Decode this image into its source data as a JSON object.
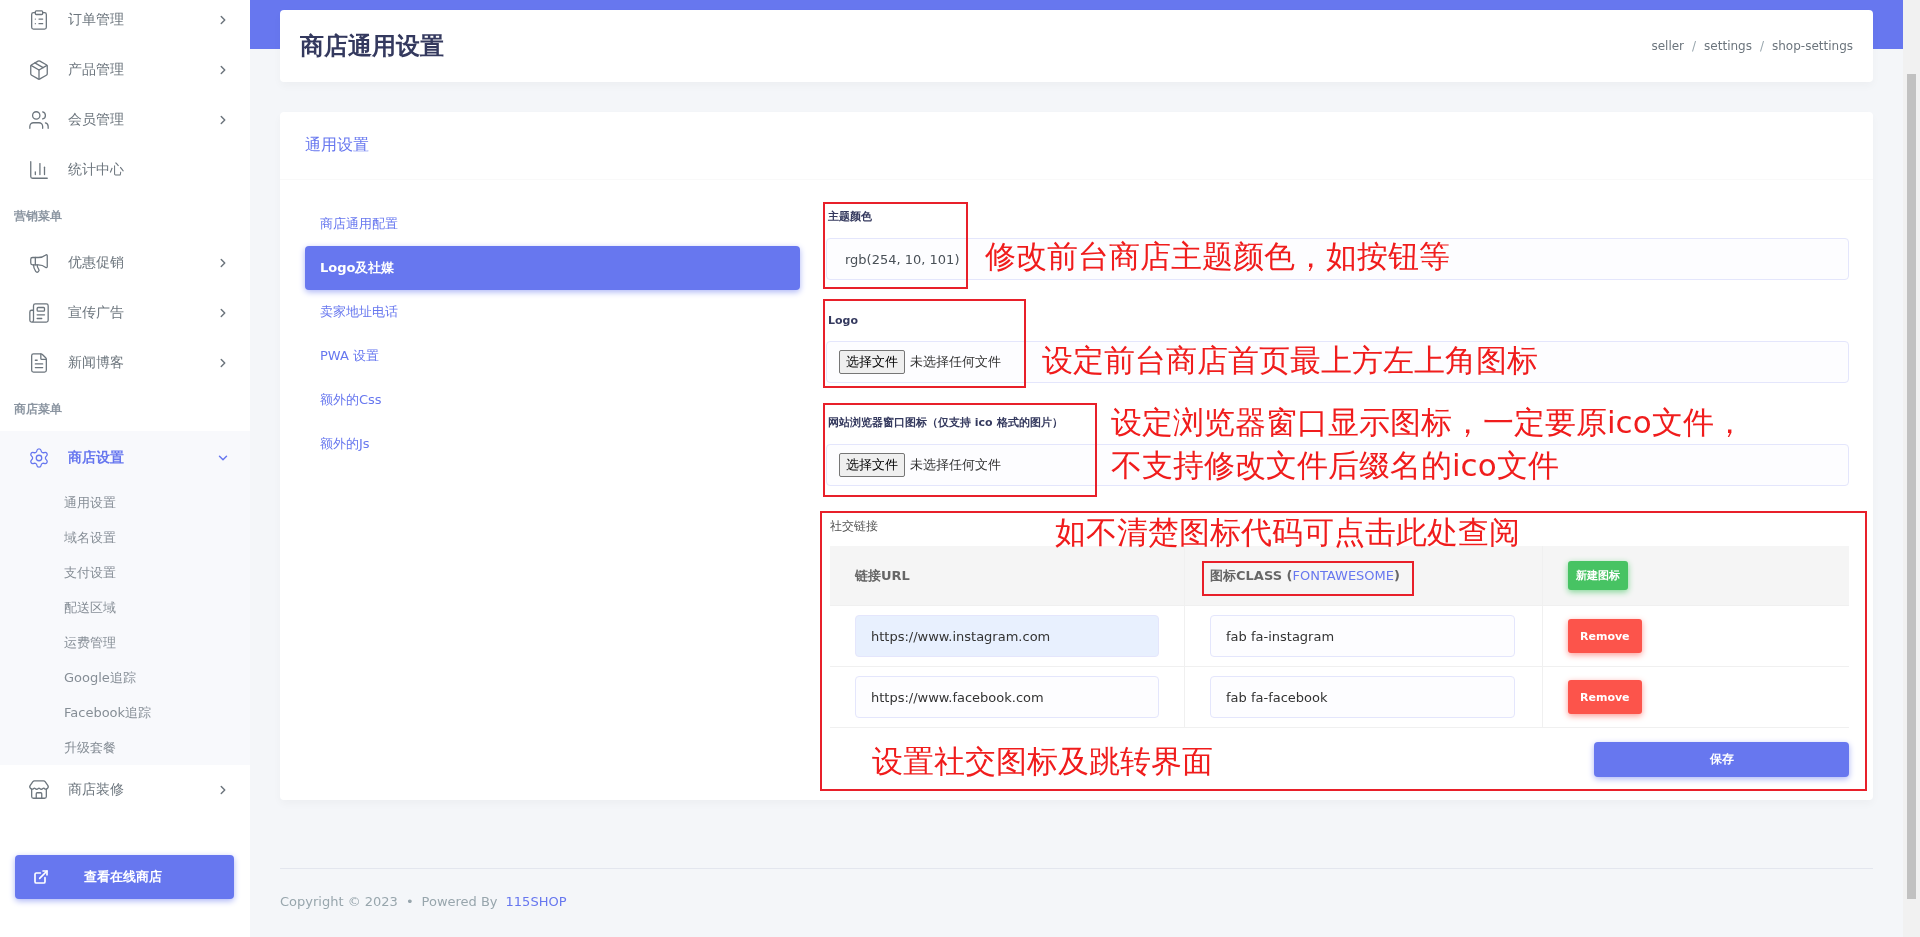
{
  "sidebar": {
    "menu": [
      {
        "kind": "item",
        "label": "订单管理",
        "expanded": false
      },
      {
        "kind": "item",
        "label": "产品管理",
        "expanded": false
      },
      {
        "kind": "item",
        "label": "会员管理",
        "expanded": false
      },
      {
        "kind": "item",
        "label": "统计中心"
      },
      {
        "kind": "heading",
        "label": "营销菜单"
      },
      {
        "kind": "item",
        "label": "优惠促销",
        "expanded": false
      },
      {
        "kind": "item",
        "label": "宣传广告",
        "expanded": false
      },
      {
        "kind": "item",
        "label": "新闻博客",
        "expanded": false
      },
      {
        "kind": "heading",
        "label": "商店菜单"
      },
      {
        "kind": "item",
        "label": "商店设置",
        "expanded": true,
        "children": [
          "通用设置",
          "域名设置",
          "支付设置",
          "配送区域",
          "运费管理",
          "Google追踪",
          "Facebook追踪",
          "升级套餐"
        ]
      },
      {
        "kind": "item",
        "label": "商店装修",
        "expanded": false
      }
    ],
    "visit_button": "查看在线商店"
  },
  "header": {
    "title": "商店通用设置",
    "breadcrumb": [
      "seller",
      "settings",
      "shop-settings"
    ],
    "breadcrumb_separator": "/"
  },
  "card": {
    "title": "通用设置",
    "tabs": [
      {
        "label": "商店通用配置",
        "selected": false
      },
      {
        "label": "Logo及社媒",
        "selected": true
      },
      {
        "label": "卖家地址电话",
        "selected": false
      },
      {
        "label": "PWA 设置",
        "selected": false
      },
      {
        "label": "额外的Css",
        "selected": false
      },
      {
        "label": "额外的Js",
        "selected": false
      }
    ],
    "theme_color": {
      "label": "主题颜色",
      "value": "rgb(254, 10, 101)"
    },
    "logo": {
      "label": "Logo",
      "button": "选择文件",
      "status": "未选择任何文件"
    },
    "favicon": {
      "label": "网站浏览器窗口图标（仅支持 ico 格式的图片）",
      "button": "选择文件",
      "status": "未选择任何文件"
    },
    "social_links": {
      "label": "社交链接",
      "columns": {
        "url": "链接URL",
        "icon_prefix": "图标CLASS (",
        "icon_link": "FONTAWESOME",
        "icon_suffix": ")"
      },
      "add_button": "新建图标",
      "rows": [
        {
          "url": "https://www.instagram.com",
          "autofilled": true,
          "icon_class": "fab fa-instagram",
          "remove": "Remove"
        },
        {
          "url": "https://www.facebook.com",
          "autofilled": false,
          "icon_class": "fab fa-facebook",
          "remove": "Remove"
        }
      ]
    },
    "save_button": "保存"
  },
  "annotations": [
    "修改前台商店主题颜色，如按钮等",
    "设定前台商店首页最上方左上角图标",
    "设定浏览器窗口显示图标，一定要原ico文件，",
    "不支持修改文件后缀名的ico文件",
    "如不清楚图标代码可点击此处查阅",
    "设置社交图标及跳转界面"
  ],
  "footer": {
    "copyright": "Copyright © 2023",
    "separator": "•",
    "powered_by": "Powered By",
    "brand": "115SHOP"
  }
}
